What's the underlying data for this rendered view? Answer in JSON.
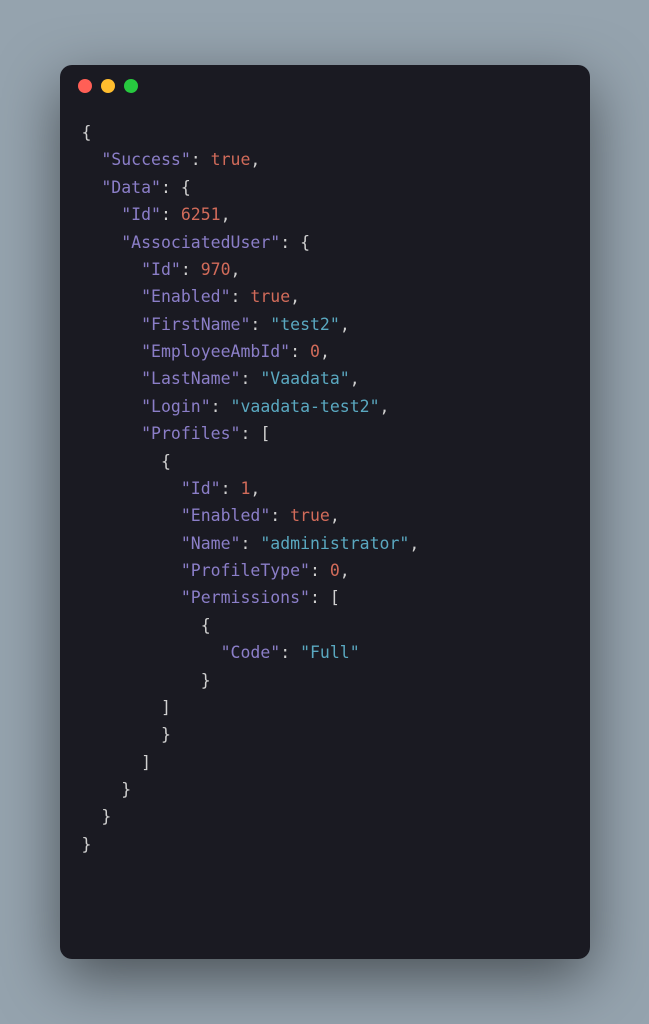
{
  "window": {
    "dots": [
      "red",
      "yellow",
      "green"
    ]
  },
  "code": {
    "json": {
      "Success": true,
      "Data": {
        "Id": 6251,
        "AssociatedUser": {
          "Id": 970,
          "Enabled": true,
          "FirstName": "test2",
          "EmployeeAmbId": 0,
          "LastName": "Vaadata",
          "Login": "vaadata-test2",
          "Profiles": [
            {
              "Id": 1,
              "Enabled": true,
              "Name": "administrator",
              "ProfileType": 0,
              "Permissions": [
                {
                  "Code": "Full"
                }
              ]
            }
          ]
        }
      }
    },
    "tokens": [
      {
        "t": "{",
        "c": "p",
        "nl": 1
      },
      {
        "t": "  ",
        "c": "p"
      },
      {
        "t": "\"Success\"",
        "c": "k"
      },
      {
        "t": ": ",
        "c": "p"
      },
      {
        "t": "true",
        "c": "b"
      },
      {
        "t": ",",
        "c": "p",
        "nl": 1
      },
      {
        "t": "  ",
        "c": "p"
      },
      {
        "t": "\"Data\"",
        "c": "k"
      },
      {
        "t": ": {",
        "c": "p",
        "nl": 1
      },
      {
        "t": "    ",
        "c": "p"
      },
      {
        "t": "\"Id\"",
        "c": "k"
      },
      {
        "t": ": ",
        "c": "p"
      },
      {
        "t": "6251",
        "c": "n"
      },
      {
        "t": ",",
        "c": "p",
        "nl": 1
      },
      {
        "t": "    ",
        "c": "p"
      },
      {
        "t": "\"AssociatedUser\"",
        "c": "k"
      },
      {
        "t": ": {",
        "c": "p",
        "nl": 1
      },
      {
        "t": "      ",
        "c": "p"
      },
      {
        "t": "\"Id\"",
        "c": "k"
      },
      {
        "t": ": ",
        "c": "p"
      },
      {
        "t": "970",
        "c": "n"
      },
      {
        "t": ",",
        "c": "p",
        "nl": 1
      },
      {
        "t": "      ",
        "c": "p"
      },
      {
        "t": "\"Enabled\"",
        "c": "k"
      },
      {
        "t": ": ",
        "c": "p"
      },
      {
        "t": "true",
        "c": "b"
      },
      {
        "t": ",",
        "c": "p",
        "nl": 1
      },
      {
        "t": "      ",
        "c": "p"
      },
      {
        "t": "\"FirstName\"",
        "c": "k"
      },
      {
        "t": ": ",
        "c": "p"
      },
      {
        "t": "\"test2\"",
        "c": "s"
      },
      {
        "t": ",",
        "c": "p",
        "nl": 1
      },
      {
        "t": "      ",
        "c": "p"
      },
      {
        "t": "\"EmployeeAmbId\"",
        "c": "k"
      },
      {
        "t": ": ",
        "c": "p"
      },
      {
        "t": "0",
        "c": "n"
      },
      {
        "t": ",",
        "c": "p",
        "nl": 1
      },
      {
        "t": "      ",
        "c": "p"
      },
      {
        "t": "\"LastName\"",
        "c": "k"
      },
      {
        "t": ": ",
        "c": "p"
      },
      {
        "t": "\"Vaadata\"",
        "c": "s"
      },
      {
        "t": ",",
        "c": "p",
        "nl": 1
      },
      {
        "t": "      ",
        "c": "p"
      },
      {
        "t": "\"Login\"",
        "c": "k"
      },
      {
        "t": ": ",
        "c": "p"
      },
      {
        "t": "\"vaadata-test2\"",
        "c": "s"
      },
      {
        "t": ",",
        "c": "p",
        "nl": 1
      },
      {
        "t": "      ",
        "c": "p"
      },
      {
        "t": "\"Profiles\"",
        "c": "k"
      },
      {
        "t": ": [",
        "c": "p",
        "nl": 1
      },
      {
        "t": "        {",
        "c": "p",
        "nl": 1
      },
      {
        "t": "          ",
        "c": "p"
      },
      {
        "t": "\"Id\"",
        "c": "k"
      },
      {
        "t": ": ",
        "c": "p"
      },
      {
        "t": "1",
        "c": "n"
      },
      {
        "t": ",",
        "c": "p",
        "nl": 1
      },
      {
        "t": "          ",
        "c": "p"
      },
      {
        "t": "\"Enabled\"",
        "c": "k"
      },
      {
        "t": ": ",
        "c": "p"
      },
      {
        "t": "true",
        "c": "b"
      },
      {
        "t": ",",
        "c": "p",
        "nl": 1
      },
      {
        "t": "          ",
        "c": "p"
      },
      {
        "t": "\"Name\"",
        "c": "k"
      },
      {
        "t": ": ",
        "c": "p"
      },
      {
        "t": "\"administrator\"",
        "c": "s"
      },
      {
        "t": ",",
        "c": "p",
        "nl": 1
      },
      {
        "t": "          ",
        "c": "p"
      },
      {
        "t": "\"ProfileType\"",
        "c": "k"
      },
      {
        "t": ": ",
        "c": "p"
      },
      {
        "t": "0",
        "c": "n"
      },
      {
        "t": ",",
        "c": "p",
        "nl": 1
      },
      {
        "t": "          ",
        "c": "p"
      },
      {
        "t": "\"Permissions\"",
        "c": "k"
      },
      {
        "t": ": [",
        "c": "p",
        "nl": 1
      },
      {
        "t": "            {",
        "c": "p",
        "nl": 1
      },
      {
        "t": "              ",
        "c": "p"
      },
      {
        "t": "\"Code\"",
        "c": "k"
      },
      {
        "t": ": ",
        "c": "p"
      },
      {
        "t": "\"Full\"",
        "c": "s",
        "nl": 1
      },
      {
        "t": "            }",
        "c": "p",
        "nl": 1
      },
      {
        "t": "        ]",
        "c": "p",
        "nl": 1
      },
      {
        "t": "        }",
        "c": "p",
        "nl": 1
      },
      {
        "t": "      ]",
        "c": "p",
        "nl": 1
      },
      {
        "t": "    }",
        "c": "p",
        "nl": 1
      },
      {
        "t": "  }",
        "c": "p",
        "nl": 1
      },
      {
        "t": "}",
        "c": "p"
      }
    ]
  }
}
